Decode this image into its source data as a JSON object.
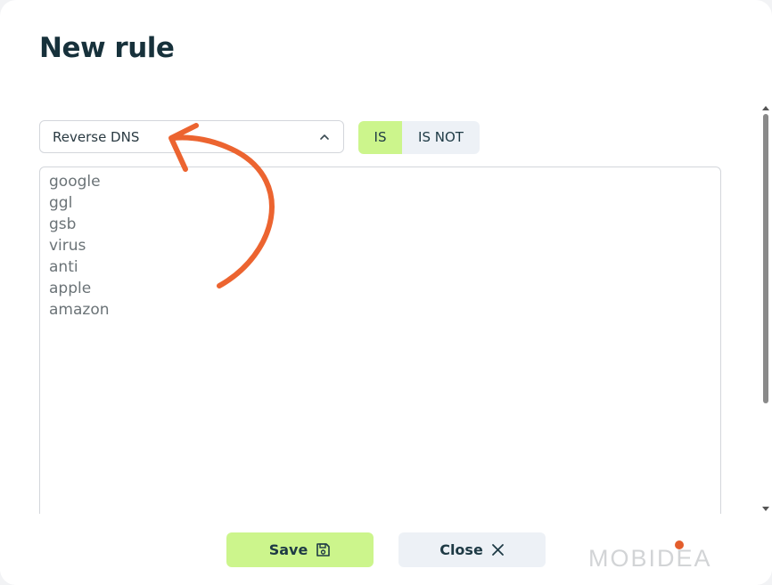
{
  "dialog": {
    "title": "New rule"
  },
  "filter": {
    "selected": "Reverse DNS",
    "toggle": {
      "options": [
        "IS",
        "IS NOT"
      ],
      "active": "IS"
    },
    "values": [
      "google",
      "ggl",
      "gsb",
      "virus",
      "anti",
      "apple",
      "amazon"
    ]
  },
  "footer": {
    "save_label": "Save",
    "close_label": "Close"
  },
  "branding": {
    "logo_text": "MOBIDEA"
  },
  "colors": {
    "accent_green": "#ccf58c",
    "annotation_arrow": "#ec6430",
    "title_text": "#17313b",
    "logo_dot": "#e35d2c"
  },
  "icons": {
    "select_chevron": "chevron-up-icon",
    "save": "floppy-disk-icon",
    "close": "close-icon",
    "annotation": "curved-arrow-icon"
  }
}
